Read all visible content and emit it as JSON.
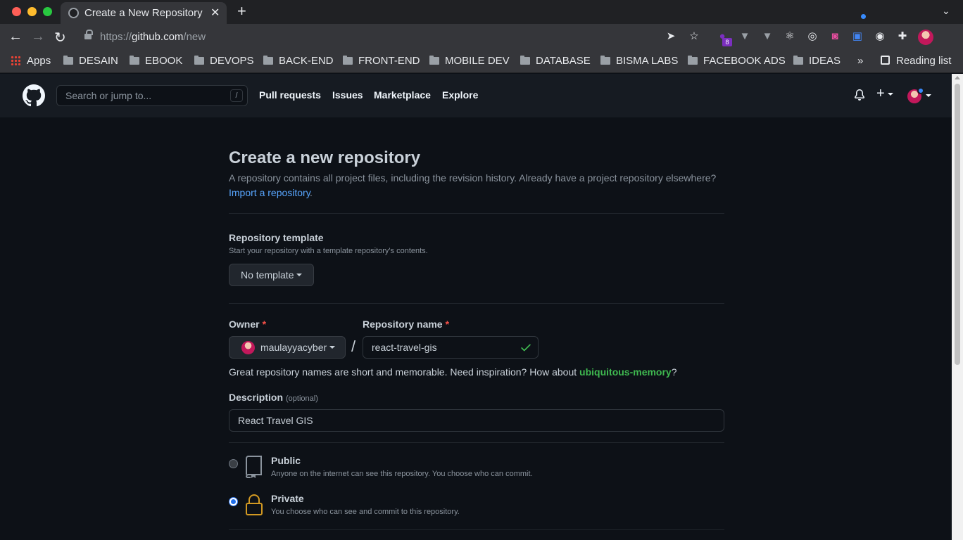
{
  "browser": {
    "tab_title": "Create a New Repository",
    "new_tab_symbol": "+",
    "url_prefix": "https://",
    "url_host": "github.com",
    "url_path": "/new",
    "extension_badge": "8",
    "bookmarks": [
      "Apps",
      "DESAIN",
      "EBOOK",
      "DEVOPS",
      "BACK-END",
      "FRONT-END",
      "MOBILE DEV",
      "DATABASE",
      "BISMA LABS",
      "FACEBOOK ADS",
      "IDEAS"
    ],
    "bookmarks_overflow": "»",
    "reading_list": "Reading list"
  },
  "header": {
    "search_placeholder": "Search or jump to...",
    "search_shortcut": "/",
    "nav": [
      "Pull requests",
      "Issues",
      "Marketplace",
      "Explore"
    ],
    "plus_symbol": "+"
  },
  "page": {
    "title": "Create a new repository",
    "subtitle": "A repository contains all project files, including the revision history. Already have a project repository elsewhere?",
    "import_link": "Import a repository",
    "import_period": ".",
    "template": {
      "label": "Repository template",
      "note": "Start your repository with a template repository's contents.",
      "button": "No template"
    },
    "owner": {
      "label": "Owner",
      "required": "*",
      "value": "maulayyacyber"
    },
    "separator": "/",
    "repo_name": {
      "label": "Repository name",
      "required": "*",
      "value": "react-travel-gis"
    },
    "suggestion_prefix": "Great repository names are short and memorable. Need inspiration? How about ",
    "suggestion_name": "ubiquitous-memory",
    "suggestion_suffix": "?",
    "description": {
      "label": "Description",
      "optional": "(optional)",
      "value": "React Travel GIS"
    },
    "visibility": [
      {
        "title": "Public",
        "desc": "Anyone on the internet can see this repository. You choose who can commit.",
        "selected": false
      },
      {
        "title": "Private",
        "desc": "You choose who can see and commit to this repository.",
        "selected": true
      }
    ]
  },
  "colors": {
    "accent_link": "#58a6ff",
    "success": "#3fb950",
    "required": "#f85149",
    "background": "#0d1117",
    "header_bg": "#161b22",
    "private_icon": "#d29922"
  }
}
